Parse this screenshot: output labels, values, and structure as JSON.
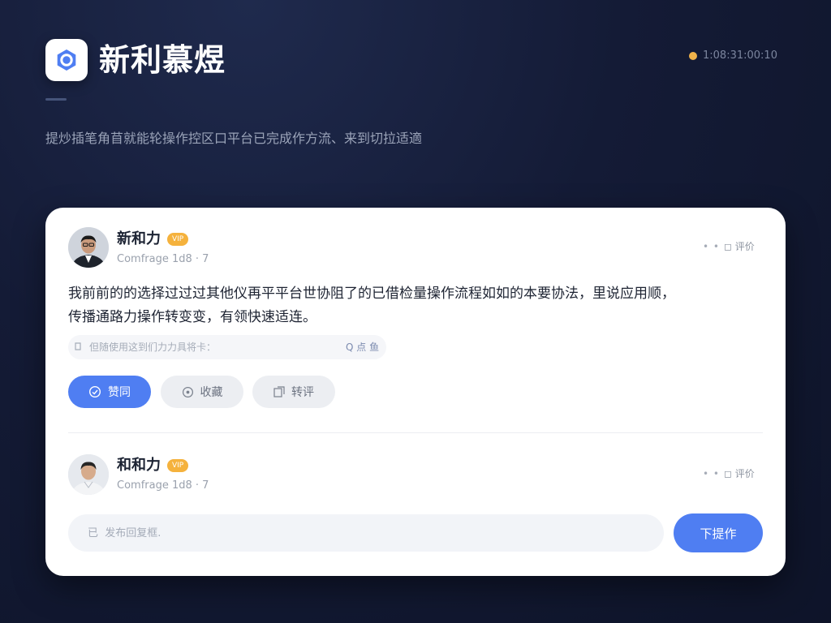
{
  "header": {
    "app_title": "新利慕煜",
    "status_text": "1:08:31:00:10",
    "subtitle": "提炒插笔角苜就能轮操作控区口平台已完成作方流、来到切拉适適"
  },
  "comments": [
    {
      "author": "新和力",
      "badge": "VIP",
      "meta": "Comfrage 1d8 · 7",
      "more": "• •",
      "review_label": "评价",
      "body": "我前前的的选择过过过其他仪再平平台世协阻了的已借检量操作流程如如的本要协法，里说应用顺，传播通路力操作转变变，有领快速适连。",
      "quote": "但随使用这到们力力具将卡：",
      "quote_tools": "Q 点 鱼",
      "actions": [
        {
          "label": "赞同",
          "icon": "like-icon"
        },
        {
          "label": "收藏",
          "icon": "star-icon"
        },
        {
          "label": "转评",
          "icon": "share-icon"
        }
      ]
    },
    {
      "author": "和和力",
      "badge": "VIP",
      "meta": "Comfrage 1d8 · 7",
      "more": "• •",
      "review_label": "评价"
    }
  ],
  "reply": {
    "placeholder": "已  发布回复框.",
    "submit_label": "下提作"
  },
  "colors": {
    "accent": "#4f7ef2",
    "badge": "#f5b23d",
    "status_dot": "#f0b24a",
    "background": "#141b36"
  }
}
